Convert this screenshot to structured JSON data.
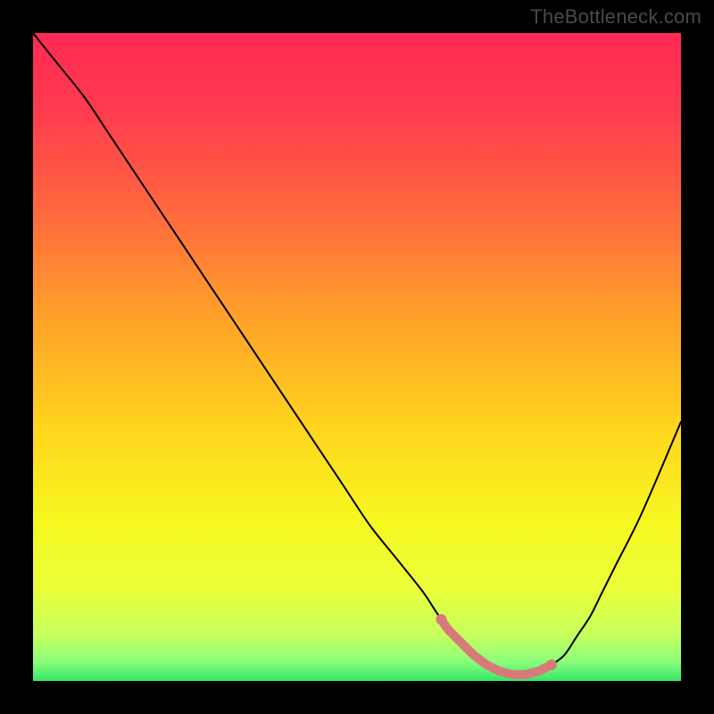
{
  "watermark": "TheBottleneck.com",
  "chart_data": {
    "type": "line",
    "title": "",
    "xlabel": "",
    "ylabel": "",
    "xlim": [
      0,
      100
    ],
    "ylim": [
      0,
      100
    ],
    "grid": false,
    "legend": false,
    "series": [
      {
        "name": "bottleneck-curve",
        "x": [
          0,
          4,
          8,
          12,
          16,
          20,
          24,
          28,
          32,
          36,
          40,
          44,
          48,
          52,
          56,
          60,
          62,
          64,
          66,
          68,
          70,
          72,
          74,
          76,
          78,
          80,
          82,
          84,
          86,
          88,
          90,
          94,
          100
        ],
        "y": [
          100,
          95,
          90,
          84,
          78,
          72,
          66,
          60,
          54,
          48,
          42,
          36,
          30,
          24,
          19,
          14,
          11,
          8,
          6,
          4,
          2.5,
          1.5,
          1,
          1,
          1.5,
          2.5,
          4,
          7,
          10,
          14,
          18,
          26,
          40
        ]
      }
    ],
    "highlight_band": {
      "name": "optimal-range",
      "x_start": 63,
      "x_end": 80,
      "color": "#d87a7a"
    },
    "gradient_stops": [
      {
        "offset": 0.0,
        "color": "#ff2a55"
      },
      {
        "offset": 0.12,
        "color": "#ff3b4e"
      },
      {
        "offset": 0.28,
        "color": "#ff6a3e"
      },
      {
        "offset": 0.44,
        "color": "#ffa229"
      },
      {
        "offset": 0.6,
        "color": "#ffd21e"
      },
      {
        "offset": 0.75,
        "color": "#f7f720"
      },
      {
        "offset": 0.86,
        "color": "#e9ff3a"
      },
      {
        "offset": 0.93,
        "color": "#c6ff5e"
      },
      {
        "offset": 0.97,
        "color": "#8bff7a"
      },
      {
        "offset": 1.0,
        "color": "#35e56a"
      }
    ]
  }
}
